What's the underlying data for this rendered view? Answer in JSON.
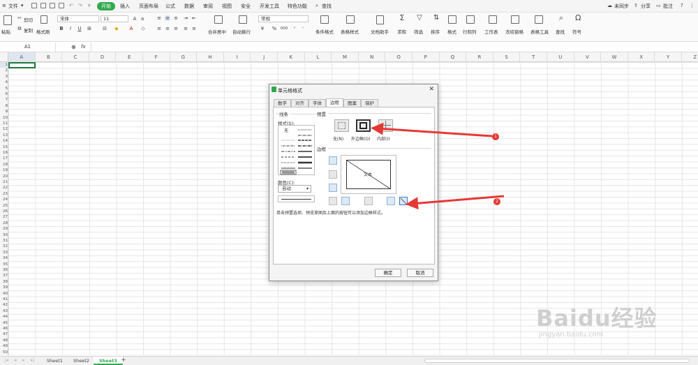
{
  "menubar": {
    "file": "文件",
    "tabs": [
      "开始",
      "插入",
      "页面布局",
      "公式",
      "数据",
      "审阅",
      "视图",
      "安全",
      "开发工具",
      "特色功能"
    ],
    "search": "查找",
    "right": {
      "unsynced": "未同步",
      "share": "分享",
      "comment": "批注"
    }
  },
  "ribbon": {
    "paste": "粘贴",
    "cut": "剪切",
    "copy": "复制",
    "format_painter": "格式刷",
    "font_name": "宋体",
    "font_size": "11",
    "merge_center": "合并居中",
    "wrap_text": "自动换行",
    "number_format": "常规",
    "conditional_format": "条件格式",
    "table_style": "表格样式",
    "doc_assistant": "文档助手",
    "sum": "求和",
    "filter": "筛选",
    "sort": "排序",
    "format": "格式",
    "rowcol": "行和列",
    "worksheet": "工作表",
    "freeze": "冻结窗格",
    "table_tools": "表格工具",
    "find": "查找",
    "symbol": "符号",
    "bold": "B",
    "italic": "I",
    "underline": "U",
    "percent": "%",
    "thousands": "000"
  },
  "formula_bar": {
    "cell_ref": "A1",
    "fx": "fx",
    "value": ""
  },
  "columns": [
    "A",
    "B",
    "C",
    "D",
    "E",
    "F",
    "G",
    "H",
    "I",
    "J",
    "K",
    "L",
    "M",
    "N",
    "O",
    "P",
    "Q",
    "R",
    "S",
    "T",
    "U",
    "V",
    "W",
    "X",
    "Y",
    "Z"
  ],
  "rows": [
    "1",
    "2",
    "3",
    "4",
    "5",
    "6",
    "7",
    "8",
    "9",
    "10",
    "11",
    "12",
    "13",
    "14",
    "15",
    "16",
    "17",
    "18",
    "19",
    "20",
    "21",
    "22",
    "23",
    "24",
    "25",
    "26",
    "27",
    "28",
    "29",
    "30",
    "31",
    "32",
    "33",
    "34",
    "35",
    "36",
    "37",
    "38",
    "39",
    "40",
    "41",
    "42",
    "43",
    "44",
    "45",
    "46",
    "47",
    "48",
    "49",
    "50"
  ],
  "sheets": [
    "Sheet1",
    "Sheet2",
    "Sheet3"
  ],
  "active_sheet": "Sheet3",
  "dialog": {
    "title": "单元格格式",
    "tabs": [
      "数字",
      "对齐",
      "字体",
      "边框",
      "图案",
      "保护"
    ],
    "active_tab": "边框",
    "line_group": "线条",
    "style_label": "样式(S):",
    "none_style": "无",
    "color_label": "颜色(C):",
    "color_value": "自动",
    "preset_group": "预置",
    "preset_none": "无(N)",
    "preset_outline": "外边框(O)",
    "preset_inside": "内部(I)",
    "border_group": "边框",
    "preview_text": "文本",
    "hint": "单击预置选项、预览草图及上面的按钮可以添加边框样式。",
    "ok": "确定",
    "cancel": "取消"
  },
  "annotations": {
    "badge1": "1",
    "badge2": "2",
    "arrow_color": "#e53935"
  },
  "watermark": {
    "brand": "Baidu经验",
    "url": "jingyan.baidu.com"
  },
  "colors": {
    "accent": "#2fa94d",
    "selection": "#1f7a3a"
  }
}
